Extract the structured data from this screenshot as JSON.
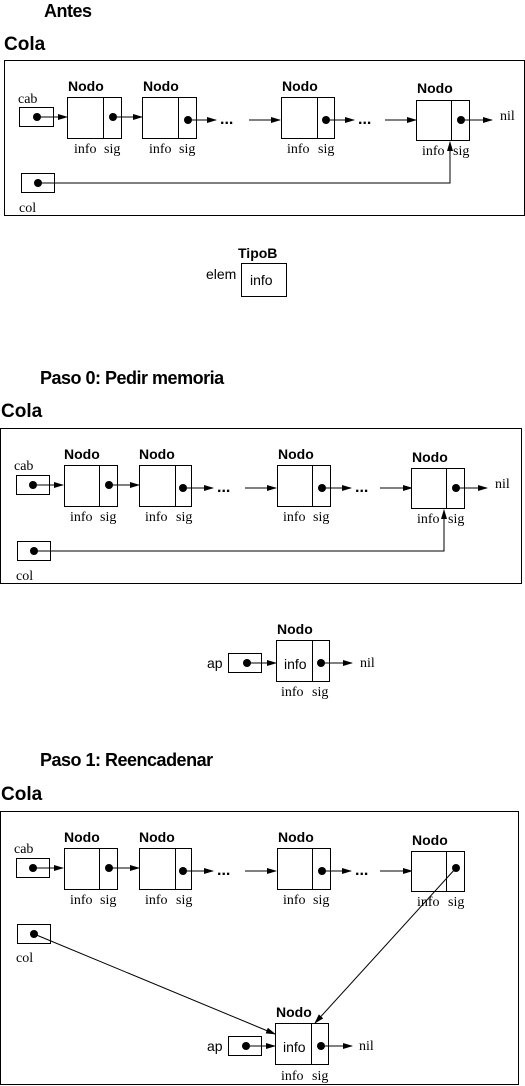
{
  "sections": {
    "antes": {
      "heading": "Antes",
      "queue_title": "Cola"
    },
    "paso0": {
      "heading": "Paso 0: Pedir memoria",
      "queue_title": "Cola"
    },
    "paso1": {
      "heading": "Paso 1: Reencadenar",
      "queue_title": "Cola"
    }
  },
  "labels": {
    "node_type": "Nodo",
    "field_info": "info",
    "field_sig": "sig",
    "pointer_cab": "cab",
    "pointer_col": "col",
    "pointer_ap": "ap",
    "nil": "nil",
    "ellipsis": "...",
    "elem_type": "TipoB",
    "elem_var": "elem",
    "elem_field": "info",
    "new_node_info": "info"
  }
}
